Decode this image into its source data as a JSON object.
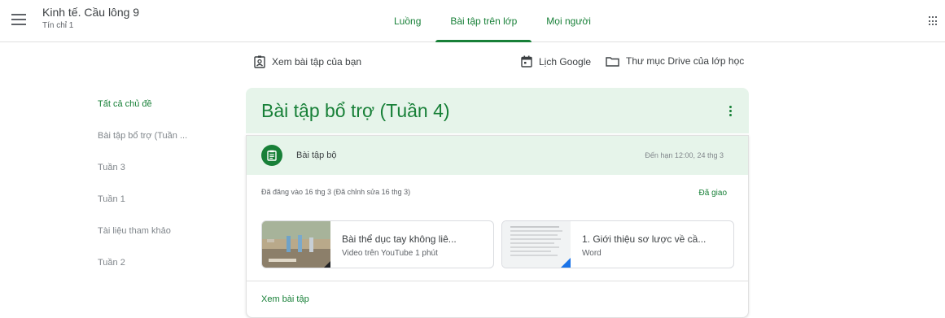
{
  "header": {
    "class_name": "Kinh tế. Cầu lông 9",
    "section": "Tín chỉ 1",
    "tabs": [
      {
        "label": "Luồng"
      },
      {
        "label": "Bài tập trên lớp"
      },
      {
        "label": "Mọi người"
      }
    ],
    "accent_color": "#188038"
  },
  "links": {
    "view_your_work": "Xem bài tập của bạn",
    "google_calendar": "Lịch Google",
    "drive_folder": "Thư mục Drive của lớp học"
  },
  "topics": [
    {
      "label": "Tất cả chủ đề",
      "active": true
    },
    {
      "label": "Bài tập bổ trợ (Tuần ..."
    },
    {
      "label": "Tuần 3"
    },
    {
      "label": "Tuần 1"
    },
    {
      "label": "Tài liệu tham khảo"
    },
    {
      "label": "Tuần 2"
    }
  ],
  "topic_section": {
    "title": "Bài tập bổ trợ (Tuần 4)"
  },
  "assignment": {
    "title": "Bài tập bộ",
    "due": "Đến hạn 12:00, 24 thg 3",
    "posted": "Đã đăng vào 16 thg 3 (Đã chỉnh sửa 16 thg 3)",
    "status": "Đã giao",
    "attachments": [
      {
        "title": "Bài thể dục tay không liê...",
        "subtitle": "Video trên YouTube   1 phút",
        "icon": "youtube-video-thumbnail"
      },
      {
        "title": "1. Giới thiệu sơ lược về cầ...",
        "subtitle": "Word",
        "icon": "word-document-thumbnail"
      }
    ],
    "view_link": "Xem bài tập"
  }
}
